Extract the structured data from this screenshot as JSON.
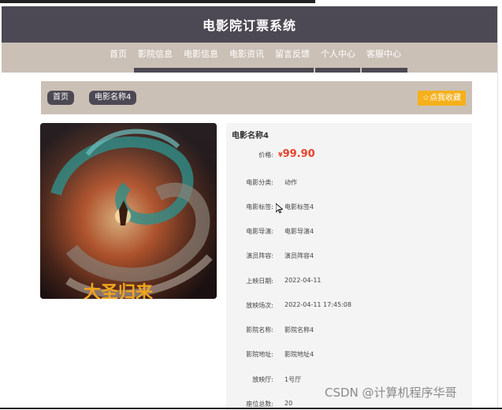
{
  "app": {
    "title": "电影院订票系统"
  },
  "nav": {
    "items": [
      {
        "label": "首页",
        "active": true
      },
      {
        "label": "影院信息"
      },
      {
        "label": "电影信息"
      },
      {
        "label": "电影资讯"
      },
      {
        "label": "留言反馈"
      },
      {
        "label": "个人中心"
      },
      {
        "label": "客服中心"
      }
    ]
  },
  "breadcrumb": {
    "home": "首页",
    "current": "电影名称4"
  },
  "favorite": {
    "label": "☆点我收藏"
  },
  "movie": {
    "name": "电影名称4",
    "price_symbol": "¥",
    "price": "99.90",
    "fields": [
      {
        "label": "价格:",
        "value": ""
      },
      {
        "label": "电影分类:",
        "value": "动作"
      },
      {
        "label": "电影标签:",
        "value": "电影标签4"
      },
      {
        "label": "电影导演:",
        "value": "电影导演4"
      },
      {
        "label": "演员阵容:",
        "value": "演员阵容4"
      },
      {
        "label": "上映日期:",
        "value": "2022-04-11"
      },
      {
        "label": "放映场次:",
        "value": "2022-04-11 17:45:08"
      },
      {
        "label": "影院名称:",
        "value": "影院名称4"
      },
      {
        "label": "影院地址:",
        "value": "影院地址4"
      },
      {
        "label": "放映厅:",
        "value": "1号厅"
      },
      {
        "label": "座位总数:",
        "value": "20"
      }
    ]
  },
  "watermark": "CSDN @计算机程序华哥",
  "colors": {
    "title_bar": "#4d4954",
    "nav_bg": "#cbc0b6",
    "price": "#e8412b",
    "favorite": "#f6b01b"
  }
}
